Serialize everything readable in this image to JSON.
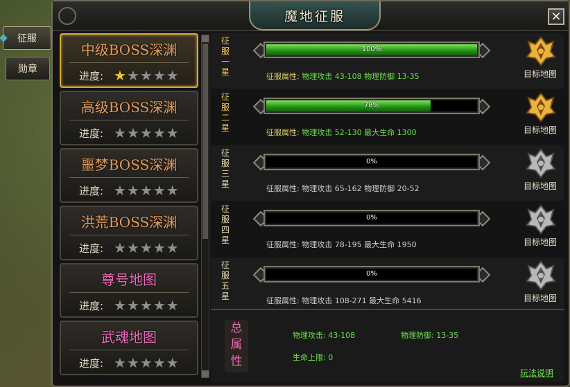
{
  "window": {
    "title": "魔地征服",
    "close": "×"
  },
  "side_tabs": [
    {
      "label": "征服"
    },
    {
      "label": "勋章"
    }
  ],
  "maps": [
    {
      "name": "中级BOSS深渊",
      "progress_label": "进度:",
      "stars": 1,
      "stars_total": 5,
      "style": "orange"
    },
    {
      "name": "高级BOSS深渊",
      "progress_label": "进度:",
      "stars": 0,
      "stars_total": 5,
      "style": "orange"
    },
    {
      "name": "噩梦BOSS深渊",
      "progress_label": "进度:",
      "stars": 0,
      "stars_total": 5,
      "style": "orange"
    },
    {
      "name": "洪荒BOSS深渊",
      "progress_label": "进度:",
      "stars": 0,
      "stars_total": 5,
      "style": "orange"
    },
    {
      "name": "尊号地图",
      "progress_label": "进度:",
      "stars": 0,
      "stars_total": 5,
      "style": "pink"
    },
    {
      "name": "武魂地图",
      "progress_label": "进度:",
      "stars": 0,
      "stars_total": 5,
      "style": "pink"
    }
  ],
  "conquests": [
    {
      "label": "征服一星",
      "progress": 100,
      "progress_text": "100%",
      "attr_key": "征服属性:",
      "attr_val": "物理攻击 43-108 物理防御 13-35",
      "map_label": "目标地图",
      "unlocked": true
    },
    {
      "label": "征服二星",
      "progress": 78,
      "progress_text": "78%",
      "attr_key": "征服属性:",
      "attr_val": "物理攻击 52-130 最大生命 1300",
      "map_label": "目标地图",
      "unlocked": true
    },
    {
      "label": "征服三星",
      "progress": 0,
      "progress_text": "0%",
      "attr_key": "征服属性:",
      "attr_val": "物理攻击 65-162 物理防御 20-52",
      "map_label": "目标地图",
      "unlocked": false
    },
    {
      "label": "征服四星",
      "progress": 0,
      "progress_text": "0%",
      "attr_key": "征服属性:",
      "attr_val": "物理攻击 78-195 最大生命 1950",
      "map_label": "目标地图",
      "unlocked": false
    },
    {
      "label": "征服五星",
      "progress": 0,
      "progress_text": "0%",
      "attr_key": "征服属性:",
      "attr_val": "物理攻击 108-271 最大生命 5416",
      "map_label": "目标地图",
      "unlocked": false
    }
  ],
  "summary": {
    "title": "总属性",
    "attack": "物理攻击: 43-108",
    "defense": "物理防御: 13-35",
    "hp": "生命上限: 0",
    "help": "玩法说明"
  },
  "colors": {
    "accent_gold": "#d7a83a",
    "green": "#6ee04c",
    "pink": "#ea6ab5",
    "orange": "#e39b5a"
  }
}
